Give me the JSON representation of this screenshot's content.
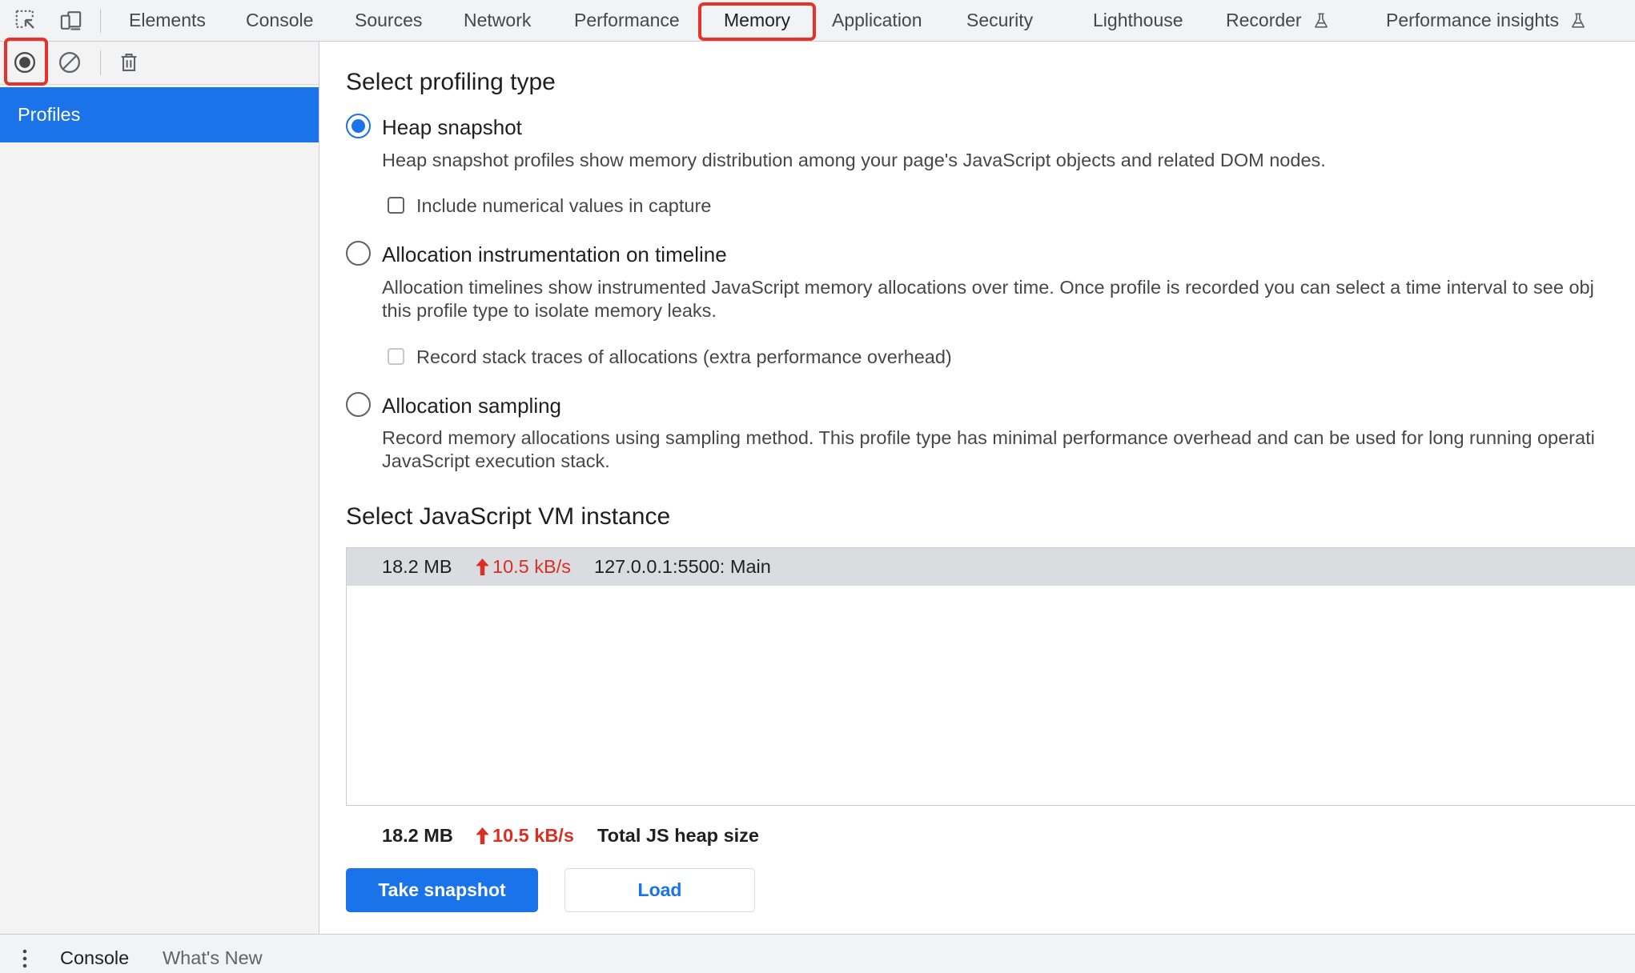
{
  "theme": {
    "accent": "#1a73e8",
    "rate_red": "#d93025",
    "annotation_red": "#e5322b"
  },
  "main_toolbar": {
    "icons": [
      "inspect-element-icon",
      "device-toolbar-icon"
    ],
    "tabs": [
      {
        "label": "Elements"
      },
      {
        "label": "Console"
      },
      {
        "label": "Sources"
      },
      {
        "label": "Network"
      },
      {
        "label": "Performance"
      },
      {
        "label": "Memory",
        "selected": true
      },
      {
        "label": "Application"
      },
      {
        "label": "Security"
      },
      {
        "label": "Lighthouse"
      },
      {
        "label": "Recorder",
        "icon": "flask-icon"
      },
      {
        "label": "Performance insights",
        "icon": "flask-icon"
      }
    ]
  },
  "memory_toolbar": {
    "icons": [
      "record-icon",
      "clear-icon",
      "trash-icon"
    ]
  },
  "sidebar": {
    "items": [
      {
        "label": "Profiles",
        "selected": true
      }
    ]
  },
  "profiling": {
    "heading": "Select profiling type",
    "options": [
      {
        "label": "Heap snapshot",
        "selected": true,
        "description": [
          "Heap snapshot profiles show memory distribution among your page's JavaScript objects and related DOM nodes."
        ],
        "checkbox": {
          "label": "Include numerical values in capture",
          "checked": false,
          "disabled": false
        }
      },
      {
        "label": "Allocation instrumentation on timeline",
        "selected": false,
        "description": [
          "Allocation timelines show instrumented JavaScript memory allocations over time. Once profile is recorded you can select a time interval to see obj",
          "this profile type to isolate memory leaks."
        ],
        "checkbox": {
          "label": "Record stack traces of allocations (extra performance overhead)",
          "checked": false,
          "disabled": true
        }
      },
      {
        "label": "Allocation sampling",
        "selected": false,
        "description": [
          "Record memory allocations using sampling method. This profile type has minimal performance overhead and can be used for long running operati",
          "JavaScript execution stack."
        ]
      }
    ]
  },
  "vm": {
    "heading": "Select JavaScript VM instance",
    "instances": [
      {
        "size": "18.2 MB",
        "trend_icon": "arrow-up-icon",
        "rate": "10.5 kB/s",
        "name": "127.0.0.1:5500: Main",
        "selected": true
      }
    ]
  },
  "totals": {
    "size": "18.2 MB",
    "trend_icon": "arrow-up-icon",
    "rate": "10.5 kB/s",
    "label": "Total JS heap size"
  },
  "actions": {
    "take_snapshot": "Take snapshot",
    "load": "Load"
  },
  "drawer": {
    "menu_icon": "kebab-menu-icon",
    "tabs": [
      {
        "label": "Console",
        "selected": true
      },
      {
        "label": "What's New"
      }
    ]
  }
}
